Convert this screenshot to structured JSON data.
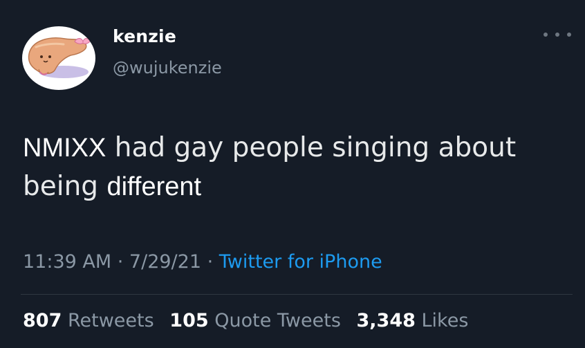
{
  "tweet": {
    "author": {
      "display_name": "kenzie",
      "handle": "@wujukenzie",
      "avatar_icon": "cartoon-bread-avatar"
    },
    "more_icon": "ellipsis-icon",
    "text": {
      "line1_overlay": "NMIXX",
      "line1_rest": " had gay people singing about",
      "line2_start": "being ",
      "line2_overlay": "different"
    },
    "meta": {
      "time": "11:39 AM",
      "sep1": " · ",
      "date": "7/29/21",
      "sep2": " · ",
      "source": "Twitter for iPhone"
    },
    "stats": {
      "retweets_count": "807",
      "retweets_label": "Retweets",
      "quotes_count": "105",
      "quotes_label": "Quote Tweets",
      "likes_count": "3,348",
      "likes_label": "Likes"
    },
    "colors": {
      "background": "#151c27",
      "link": "#1d9bf0",
      "muted": "#8b98a5"
    }
  }
}
